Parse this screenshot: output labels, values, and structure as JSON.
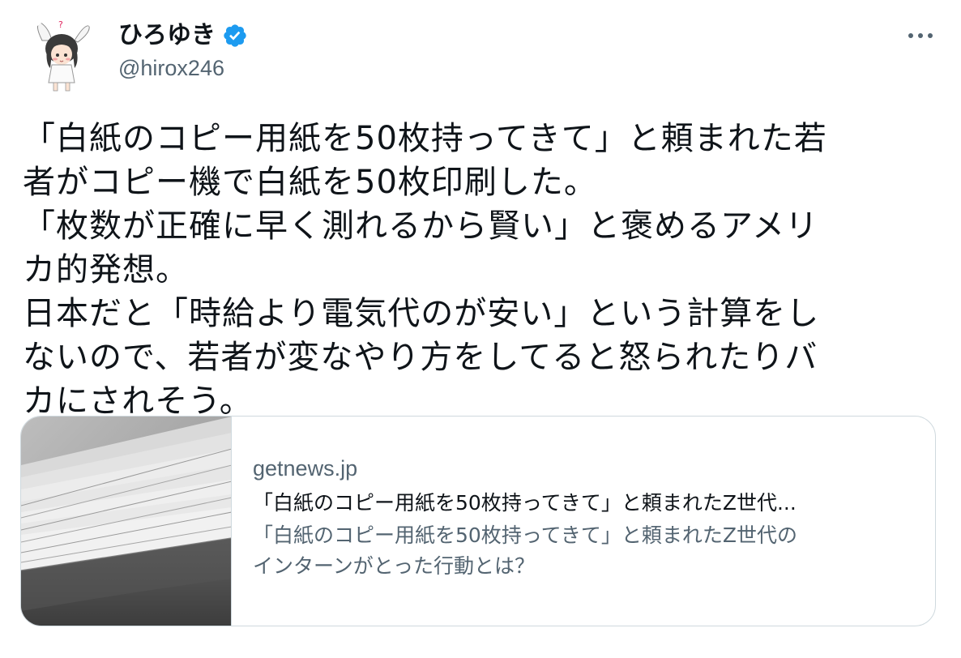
{
  "author": {
    "display_name": "ひろゆき",
    "handle": "@hirox246",
    "verified": true,
    "avatar_icon": "avatar-icon",
    "verified_icon": "verified-badge-icon",
    "more_icon": "more-options-icon"
  },
  "tweet": {
    "lines": [
      "「白紙のコピー用紙を50枚持ってきて」と頼まれた若",
      "者がコピー機で白紙を50枚印刷した。",
      "「枚数が正確に早く測れるから賢い」と褒めるアメリ",
      "カ的発想。",
      "日本だと「時給より電気代のが安い」という計算をし",
      "ないので、若者が変なやり方をしてると怒られたりバ",
      "カにされそう。"
    ]
  },
  "card": {
    "domain": "getnews.jp",
    "title": "「白紙のコピー用紙を50枚持ってきて」と頼まれたZ世代...",
    "description_lines": [
      "「白紙のコピー用紙を50枚持ってきて」と頼まれたZ世代の",
      "インターンがとった行動とは？"
    ]
  },
  "colors": {
    "text": "#0f1419",
    "secondary": "#536471",
    "border": "#cfd9de",
    "verified": "#1d9bf0"
  }
}
